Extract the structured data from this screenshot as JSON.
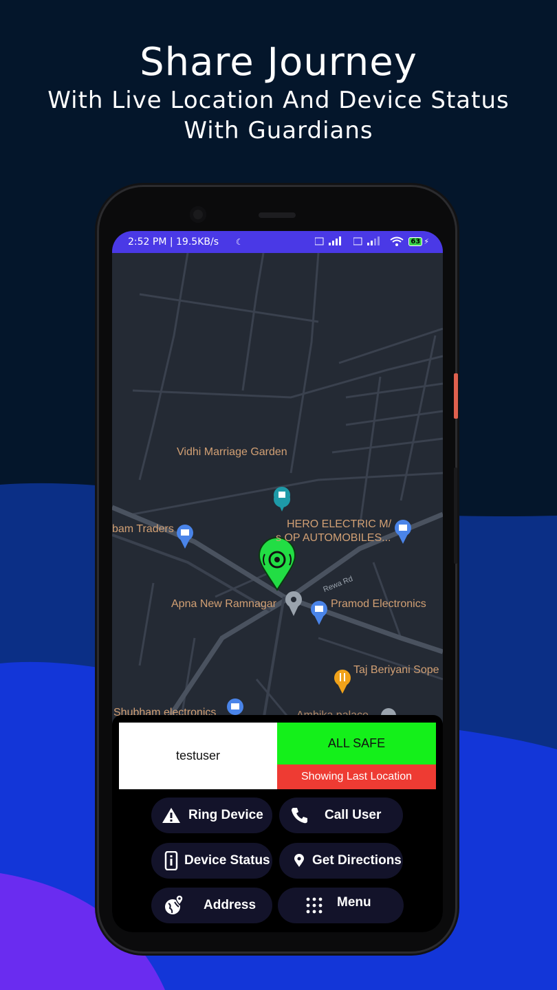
{
  "headline": {
    "title": "Share Journey",
    "subtitle_line1": "With Live Location And Device Status",
    "subtitle_line2": "With Guardians"
  },
  "status_bar": {
    "time_speed": "2:52 PM | 19.5KB/s",
    "battery": "63"
  },
  "map": {
    "pois": [
      "Vidhi Marriage Garden",
      "bam Traders",
      "HERO ELECTRIC M/",
      "s OP AUTOMOBILES...",
      "Apna New Ramnagar",
      "Pramod Electronics",
      "Taj Beriyani Sope",
      "Shubham electronics",
      "Ambika palace"
    ],
    "road_label": "Rewa Rd"
  },
  "panel": {
    "username": "testuser",
    "status": "ALL SAFE",
    "location_note": "Showing Last Location",
    "buttons": {
      "ring_device": "Ring Device",
      "call_user": "Call User",
      "device_status": "Device Status",
      "get_directions": "Get Directions",
      "address": "Address",
      "menu": "Menu"
    }
  },
  "colors": {
    "status_bar": "#4a39e6",
    "safe": "#14f01a",
    "warning": "#ee3b33",
    "pin": "#22dd44"
  }
}
